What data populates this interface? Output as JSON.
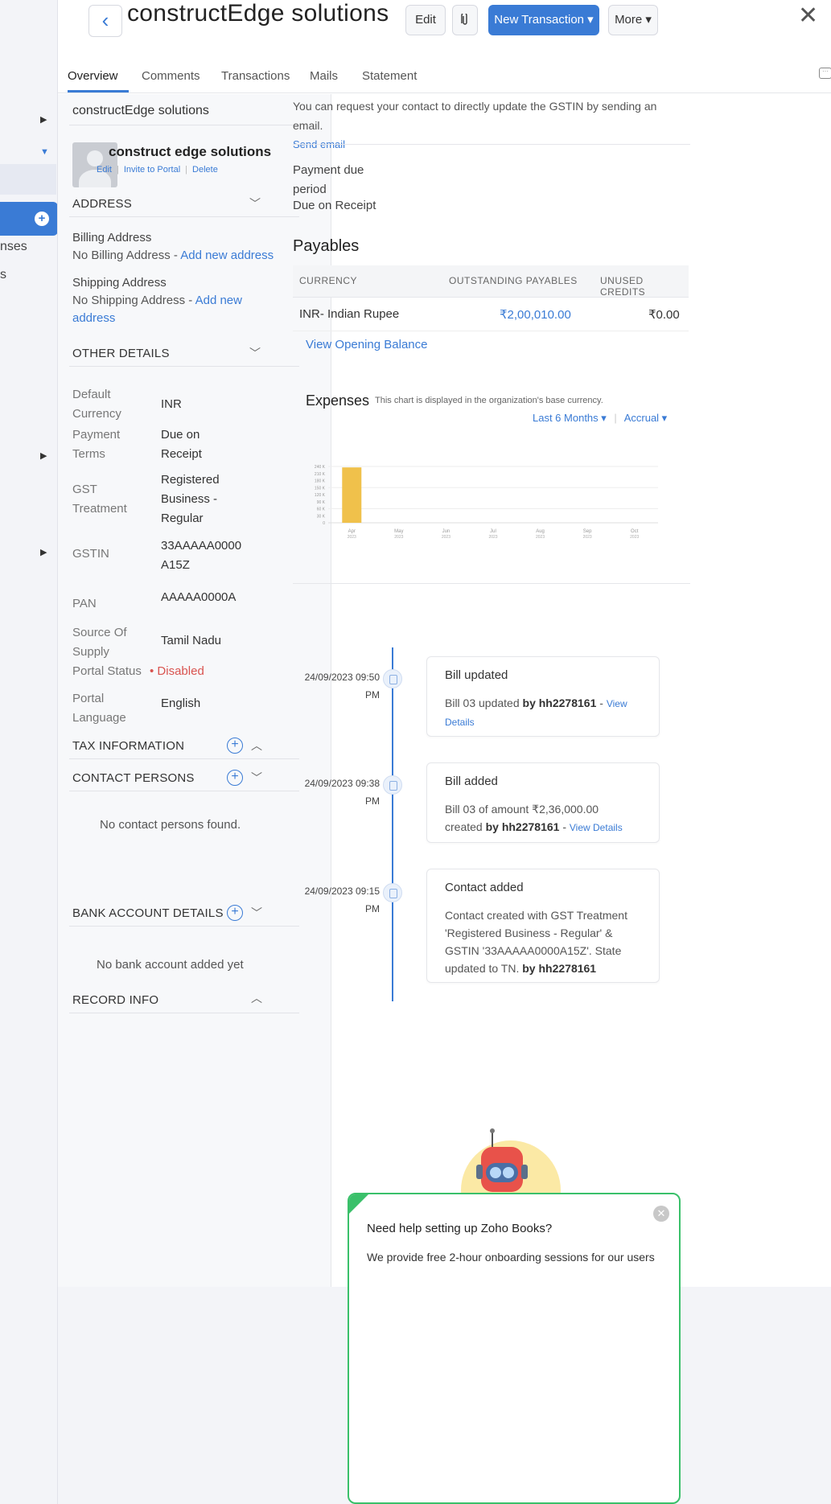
{
  "header": {
    "back": "‹",
    "title": "constructEdge solutions",
    "edit_label": "Edit",
    "attach_icon": "paperclip-icon",
    "new_transaction_label": "New Transaction ▾",
    "more_label": "More ▾",
    "close": "✕"
  },
  "tabs": [
    {
      "label": "Overview"
    },
    {
      "label": "Comments"
    },
    {
      "label": "Transactions"
    },
    {
      "label": "Mails"
    },
    {
      "label": "Statement"
    }
  ],
  "sidebar_fragments": {
    "item1": "nses",
    "item2": "s"
  },
  "contact": {
    "display_name": "constructEdge solutions",
    "person_name": "construct edge solutions",
    "links": {
      "edit": "Edit",
      "invite": "Invite to Portal",
      "delete": "Delete"
    }
  },
  "address": {
    "heading": "ADDRESS",
    "billing_label": "Billing Address",
    "billing_none": "No Billing Address - ",
    "billing_add": "Add new address",
    "shipping_label": "Shipping Address",
    "shipping_none": "No Shipping Address - ",
    "shipping_add_1": "Add new",
    "shipping_add_2": "address"
  },
  "other_details": {
    "heading": "OTHER DETAILS",
    "rows": [
      {
        "label_1": "Default",
        "label_2": "Currency",
        "value_1": "INR",
        "value_2": ""
      },
      {
        "label_1": "Payment",
        "label_2": "Terms",
        "value_1": "Due on",
        "value_2": "Receipt"
      },
      {
        "label_1": "GST",
        "label_2": "Treatment",
        "value_1": "Registered",
        "value_2": "Business -",
        "value_3": "Regular"
      },
      {
        "label_1": "GSTIN",
        "value_1": "33AAAAA0000",
        "value_2": "A15Z"
      },
      {
        "label_1": "PAN",
        "value_1": "AAAAA0000A"
      },
      {
        "label_1": "Source Of",
        "label_2": "Supply",
        "value_1": "Tamil Nadu"
      },
      {
        "label_1": "Portal Status",
        "value_1": "• Disabled"
      },
      {
        "label_1": "Portal",
        "label_2": "Language",
        "value_1": "English"
      }
    ]
  },
  "tax_info": {
    "heading": "TAX INFORMATION"
  },
  "contact_persons": {
    "heading": "CONTACT PERSONS",
    "empty": "No contact persons found."
  },
  "bank": {
    "heading": "BANK ACCOUNT DETAILS",
    "empty": "No bank account added yet"
  },
  "record_info": {
    "heading": "RECORD INFO"
  },
  "right": {
    "gstin_note": "You can request your contact to directly update the GSTIN by sending an email.",
    "send_email": "Send email",
    "payment_due_1": "Payment due",
    "payment_due_2": "period",
    "payment_due_value": "Due on Receipt",
    "payables_heading": "Payables",
    "payables": {
      "columns": [
        "CURRENCY",
        "OUTSTANDING PAYABLES",
        "UNUSED CREDITS"
      ],
      "rows": [
        {
          "currency": "INR- Indian Rupee",
          "outstanding": "₹2,00,010.00",
          "unused": "₹0.00"
        }
      ]
    },
    "view_opening_balance": "View Opening Balance",
    "expenses_title": "Expenses",
    "expenses_note": "This chart is displayed in the organization's base currency.",
    "period_filter": "Last 6 Months ▾",
    "basis_filter": "Accrual ▾"
  },
  "chart_data": {
    "type": "bar",
    "categories": [
      "Apr 2023",
      "May 2023",
      "Jun 2023",
      "Jul 2023",
      "Aug 2023",
      "Sep 2023",
      "Oct 2023"
    ],
    "values": [
      236000,
      0,
      0,
      0,
      0,
      0,
      0
    ],
    "y_ticks": [
      "240 K",
      "210 K",
      "180 K",
      "150 K",
      "120 K",
      "90 K",
      "60 K",
      "30 K",
      "0"
    ],
    "ylim": [
      0,
      240000
    ],
    "bar_color": "#f0c14b"
  },
  "timeline": [
    {
      "date": "24/09/2023 09:50",
      "ampm": "PM",
      "title": "Bill updated",
      "body_1": "Bill 03 updated ",
      "by": "by hh2278161",
      "dash": " - ",
      "link_1": "View",
      "link_2": "Details"
    },
    {
      "date": "24/09/2023 09:38",
      "ampm": "PM",
      "title": "Bill added",
      "body_1": "Bill 03 of amount ₹2,36,000.00",
      "body_2": "created ",
      "by": "by hh2278161",
      "dash": " - ",
      "link_1": "View Details"
    },
    {
      "date": "24/09/2023 09:15",
      "ampm": "PM",
      "title": "Contact added",
      "body_1": "Contact created with GST Treatment",
      "body_2": "'Registered Business - Regular' &",
      "body_3": "GSTIN '33AAAAA0000A15Z'. State",
      "body_4": "updated to TN. ",
      "by": "by hh2278161"
    }
  ],
  "help": {
    "heading": "Need help setting up Zoho Books?",
    "body": "We provide free 2-hour onboarding sessions for our users"
  }
}
